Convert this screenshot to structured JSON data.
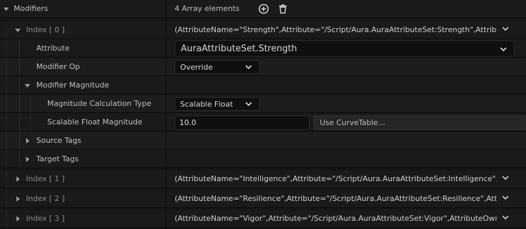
{
  "modifiers": {
    "label": "Modifiers",
    "count_text": "4 Array elements",
    "add_icon": "plus-circle",
    "delete_icon": "trash"
  },
  "index0": {
    "label": "Index [ 0 ]",
    "value": "(AttributeName=\"Strength\",Attribute=\"/Script/Aura.AuraAttributeSet:Strength\",AttributeOwn"
  },
  "attribute": {
    "label": "Attribute",
    "value": "AuraAttributeSet.Strength"
  },
  "modifier_op": {
    "label": "Modifier Op",
    "value": "Override"
  },
  "modifier_magnitude": {
    "label": "Modifier Magnitude"
  },
  "calc_type": {
    "label": "Magnitude Calculation Type",
    "value": "Scalable Float"
  },
  "scalable_float": {
    "label": "Scalable Float Magnitude",
    "value": "10.0",
    "curve_label": "Use CurveTable..."
  },
  "source_tags": {
    "label": "Source Tags"
  },
  "target_tags": {
    "label": "Target Tags"
  },
  "index1": {
    "label": "Index [ 1 ]",
    "value": "(AttributeName=\"Intelligence\",Attribute=\"/Script/Aura.AuraAttributeSet:Intelligence\",Attribut"
  },
  "index2": {
    "label": "Index [ 2 ]",
    "value": "(AttributeName=\"Resilience\",Attribute=\"/Script/Aura.AuraAttributeSet:Resilience\",AttributeC"
  },
  "index3": {
    "label": "Index [ 3 ]",
    "value": "(AttributeName=\"Vigor\",Attribute=\"/Script/Aura.AuraAttributeSet:Vigor\",AttributeOwner=\"/Sc"
  },
  "colors": {
    "background": "#151515",
    "row": "#1a1a1a",
    "text": "#c0c0c0",
    "dim_text": "#8a8a8a"
  }
}
